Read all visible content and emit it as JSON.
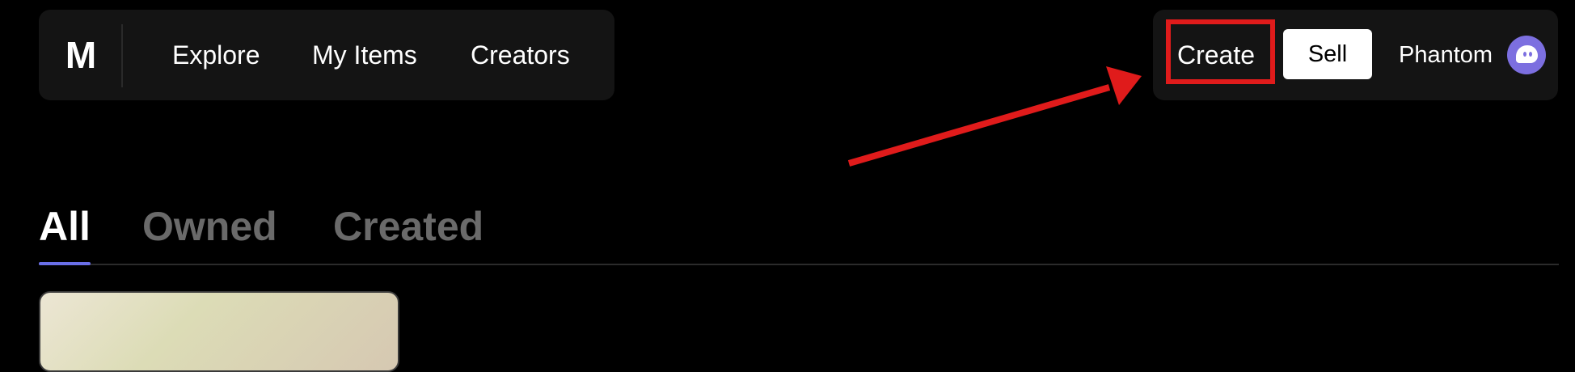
{
  "header": {
    "logo": "M",
    "nav_links": [
      "Explore",
      "My Items",
      "Creators"
    ],
    "create_label": "Create",
    "sell_label": "Sell",
    "wallet_name": "Phantom",
    "wallet_icon": "phantom-ghost-icon"
  },
  "tabs": {
    "items": [
      "All",
      "Owned",
      "Created"
    ],
    "active": "All"
  },
  "colors": {
    "background": "#000000",
    "nav_bg": "#141414",
    "highlight": "#e01b1b",
    "tab_accent": "#6a6fe8",
    "wallet_avatar": "#7c6fe0"
  },
  "annotation": {
    "type": "arrow",
    "color": "#e01b1b"
  }
}
